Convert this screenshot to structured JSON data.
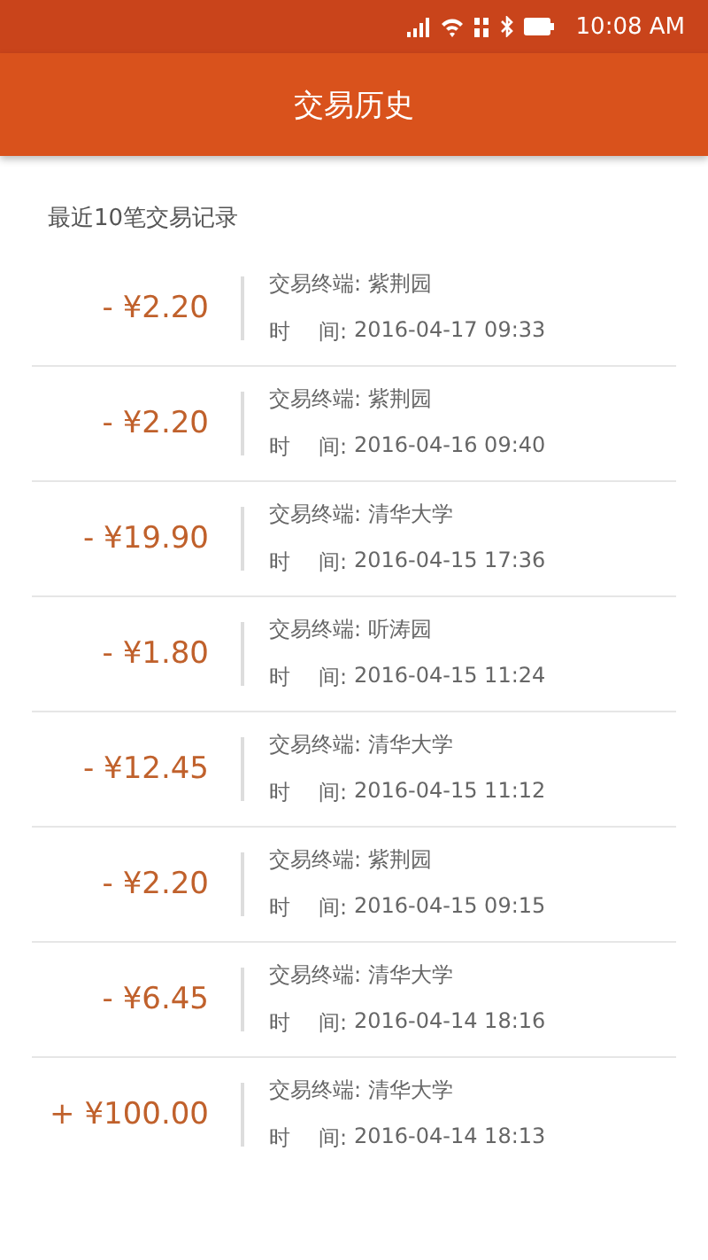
{
  "status_bar": {
    "time": "10:08 AM"
  },
  "header": {
    "title": "交易历史"
  },
  "subtitle": "最近10笔交易记录",
  "transactions": [
    {
      "amount": "- ¥2.20",
      "terminal": "交易终端: 紫荆园",
      "time_label": [
        "时",
        "间:"
      ],
      "time": "2016-04-17 09:33"
    },
    {
      "amount": "- ¥2.20",
      "terminal": "交易终端: 紫荆园",
      "time_label": [
        "时",
        "间:"
      ],
      "time": "2016-04-16 09:40"
    },
    {
      "amount": "- ¥19.90",
      "terminal": "交易终端: 清华大学",
      "time_label": [
        "时",
        "间:"
      ],
      "time": "2016-04-15 17:36"
    },
    {
      "amount": "- ¥1.80",
      "terminal": "交易终端: 听涛园",
      "time_label": [
        "时",
        "间:"
      ],
      "time": "2016-04-15 11:24"
    },
    {
      "amount": "- ¥12.45",
      "terminal": "交易终端: 清华大学",
      "time_label": [
        "时",
        "间:"
      ],
      "time": "2016-04-15 11:12"
    },
    {
      "amount": "- ¥2.20",
      "terminal": "交易终端: 紫荆园",
      "time_label": [
        "时",
        "间:"
      ],
      "time": "2016-04-15 09:15"
    },
    {
      "amount": "- ¥6.45",
      "terminal": "交易终端: 清华大学",
      "time_label": [
        "时",
        "间:"
      ],
      "time": "2016-04-14 18:16"
    },
    {
      "amount": "+ ¥100.00",
      "terminal": "交易终端: 清华大学",
      "time_label": [
        "时",
        "间:"
      ],
      "time": "2016-04-14 18:13"
    }
  ]
}
